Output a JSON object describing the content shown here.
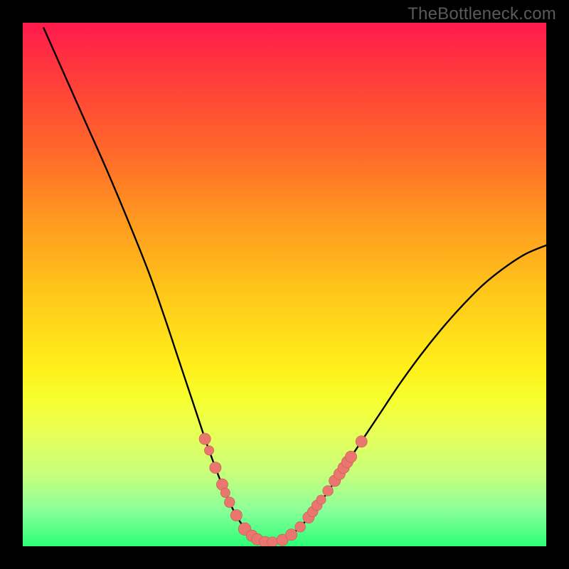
{
  "attribution": "TheBottleneck.com",
  "colors": {
    "curve": "#000000",
    "marker_fill": "#e9776f",
    "marker_stroke": "#c45850",
    "frame": "#000000"
  },
  "chart_data": {
    "type": "line",
    "title": "",
    "xlabel": "",
    "ylabel": "",
    "xlim": [
      0,
      100
    ],
    "ylim": [
      0,
      100
    ],
    "grid": false,
    "legend": false,
    "curve": [
      {
        "x": 4.0,
        "y": 99.0
      },
      {
        "x": 8.0,
        "y": 90.0
      },
      {
        "x": 12.0,
        "y": 81.0
      },
      {
        "x": 16.0,
        "y": 72.0
      },
      {
        "x": 20.0,
        "y": 62.5
      },
      {
        "x": 24.0,
        "y": 52.5
      },
      {
        "x": 27.0,
        "y": 44.0
      },
      {
        "x": 30.0,
        "y": 35.0
      },
      {
        "x": 33.0,
        "y": 26.0
      },
      {
        "x": 35.0,
        "y": 20.0
      },
      {
        "x": 37.0,
        "y": 14.5
      },
      {
        "x": 39.0,
        "y": 9.5
      },
      {
        "x": 41.0,
        "y": 5.5
      },
      {
        "x": 43.0,
        "y": 2.7
      },
      {
        "x": 45.0,
        "y": 1.2
      },
      {
        "x": 47.0,
        "y": 0.7
      },
      {
        "x": 49.0,
        "y": 1.0
      },
      {
        "x": 51.0,
        "y": 2.0
      },
      {
        "x": 53.0,
        "y": 3.7
      },
      {
        "x": 55.0,
        "y": 6.0
      },
      {
        "x": 58.0,
        "y": 10.0
      },
      {
        "x": 61.0,
        "y": 14.5
      },
      {
        "x": 64.0,
        "y": 19.0
      },
      {
        "x": 68.0,
        "y": 25.0
      },
      {
        "x": 72.0,
        "y": 31.0
      },
      {
        "x": 76.0,
        "y": 36.5
      },
      {
        "x": 80.0,
        "y": 41.5
      },
      {
        "x": 84.0,
        "y": 46.0
      },
      {
        "x": 88.0,
        "y": 50.0
      },
      {
        "x": 92.0,
        "y": 53.2
      },
      {
        "x": 96.0,
        "y": 55.8
      },
      {
        "x": 100.0,
        "y": 57.5
      }
    ],
    "markers": [
      {
        "x": 34.8,
        "y": 20.5,
        "r": 1.1
      },
      {
        "x": 35.6,
        "y": 18.3,
        "r": 0.9
      },
      {
        "x": 36.8,
        "y": 15.0,
        "r": 1.1
      },
      {
        "x": 38.1,
        "y": 11.8,
        "r": 1.1
      },
      {
        "x": 38.7,
        "y": 10.2,
        "r": 0.9
      },
      {
        "x": 39.5,
        "y": 8.4,
        "r": 1.0
      },
      {
        "x": 40.8,
        "y": 5.9,
        "r": 1.1
      },
      {
        "x": 42.4,
        "y": 3.3,
        "r": 1.2
      },
      {
        "x": 43.8,
        "y": 2.0,
        "r": 1.1
      },
      {
        "x": 44.8,
        "y": 1.3,
        "r": 1.1
      },
      {
        "x": 46.3,
        "y": 0.8,
        "r": 1.1
      },
      {
        "x": 47.7,
        "y": 0.8,
        "r": 1.0
      },
      {
        "x": 49.6,
        "y": 1.2,
        "r": 1.1
      },
      {
        "x": 51.3,
        "y": 2.2,
        "r": 1.1
      },
      {
        "x": 53.0,
        "y": 3.7,
        "r": 1.0
      },
      {
        "x": 54.6,
        "y": 5.5,
        "r": 1.1
      },
      {
        "x": 55.4,
        "y": 6.6,
        "r": 1.0
      },
      {
        "x": 56.2,
        "y": 7.8,
        "r": 1.0
      },
      {
        "x": 57.0,
        "y": 8.9,
        "r": 0.9
      },
      {
        "x": 58.3,
        "y": 10.6,
        "r": 1.0
      },
      {
        "x": 59.6,
        "y": 12.5,
        "r": 1.1
      },
      {
        "x": 60.5,
        "y": 13.8,
        "r": 1.1
      },
      {
        "x": 61.3,
        "y": 15.0,
        "r": 1.1
      },
      {
        "x": 62.0,
        "y": 16.1,
        "r": 1.1
      },
      {
        "x": 62.7,
        "y": 17.1,
        "r": 1.1
      },
      {
        "x": 64.7,
        "y": 20.0,
        "r": 1.1
      }
    ]
  }
}
